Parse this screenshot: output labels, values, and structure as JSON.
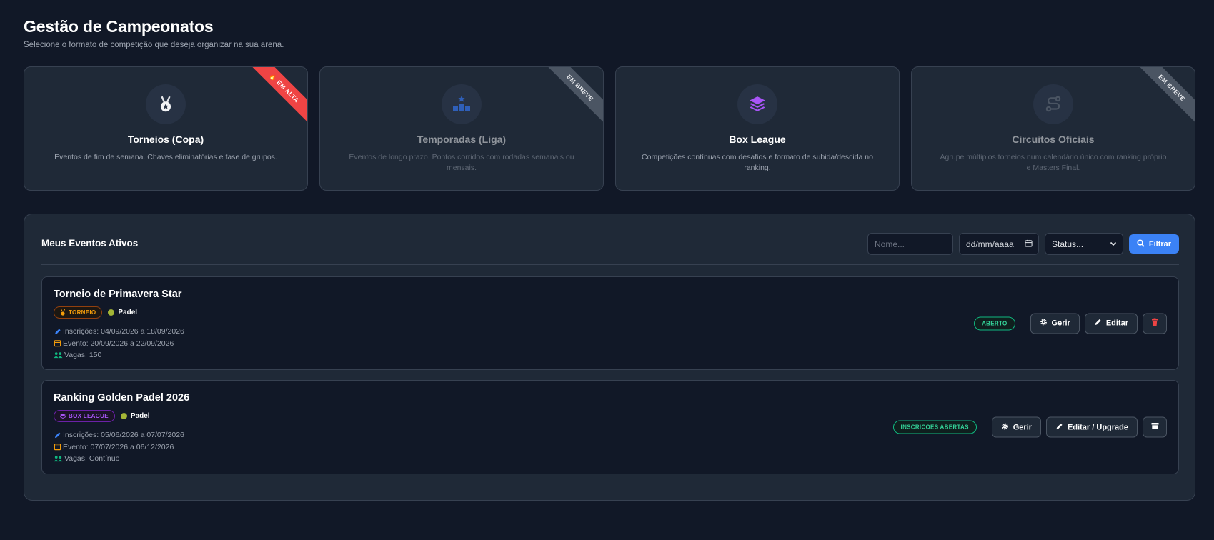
{
  "header": {
    "title": "Gestão de Campeonatos",
    "subtitle": "Selecione o formato de competição que deseja organizar na sua arena."
  },
  "formats": [
    {
      "icon": "medal-icon",
      "title": "Torneios (Copa)",
      "description": "Eventos de fim de semana. Chaves eliminatórias e fase de grupos.",
      "ribbon": "🔥 EM ALTA",
      "ribbon_color": "#ef4444"
    },
    {
      "icon": "podium-icon",
      "title": "Temporadas (Liga)",
      "description": "Eventos de longo prazo. Pontos corridos com rodadas semanais ou mensais.",
      "ribbon": "EM BREVE"
    },
    {
      "icon": "layers-icon",
      "title": "Box League",
      "description": "Competições contínuas com desafios e formato de subida/descida no ranking.",
      "ribbon": ""
    },
    {
      "icon": "route-icon",
      "title": "Circuitos Oficiais",
      "description": "Agrupe múltiplos torneios num calendário único com ranking próprio e Masters Final.",
      "ribbon": "EM BREVE"
    }
  ],
  "events_panel": {
    "title": "Meus Eventos Ativos",
    "filters": {
      "name_placeholder": "Nome...",
      "date_placeholder": "dd/mm/aaaa",
      "status_selected": "Status...",
      "filter_label": "Filtrar"
    }
  },
  "events": [
    {
      "title": "Torneio de Primavera Star",
      "type_tag": "TORNEIO",
      "sport": "Padel",
      "inscricoes": "Inscrições: 04/09/2026 a 18/09/2026",
      "evento": "Evento: 20/09/2026 a 22/09/2026",
      "vagas": "Vagas: 150",
      "status": "ABERTO",
      "manage_label": "Gerir",
      "edit_label": "Editar"
    },
    {
      "title": "Ranking Golden Padel 2026",
      "type_tag": "BOX LEAGUE",
      "sport": "Padel",
      "inscricoes": "Inscrições: 05/06/2026 a 07/07/2026",
      "evento": "Evento: 07/07/2026 a 06/12/2026",
      "vagas": "Vagas: Contínuo",
      "status": "INSCRICOES ABERTAS",
      "manage_label": "Gerir",
      "edit_label": "Editar / Upgrade"
    }
  ],
  "colors": {
    "background": "#111827",
    "card": "#1f2937",
    "accent": "#3b82f6",
    "hot": "#ef4444",
    "success": "#10b981",
    "torneio": "#f59e0b",
    "box_league": "#a855f7"
  }
}
